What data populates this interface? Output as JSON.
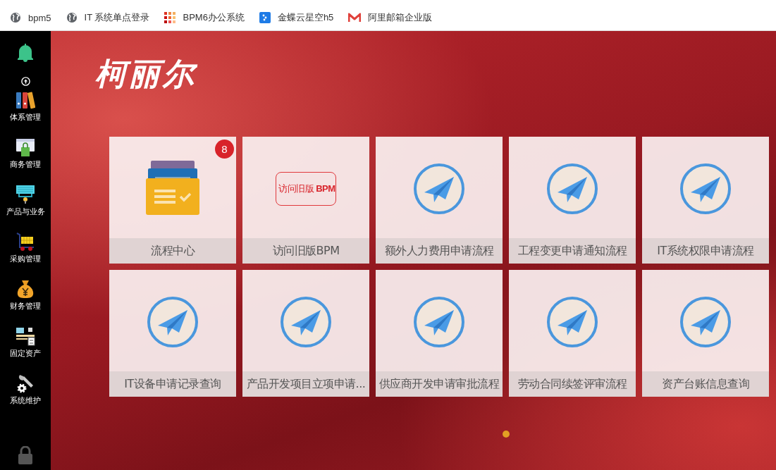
{
  "bookmarks": [
    {
      "label": "bpm5",
      "kind": "globe"
    },
    {
      "label": "IT 系统单点登录",
      "kind": "globe"
    },
    {
      "label": "BPM6办公系统",
      "kind": "grid"
    },
    {
      "label": "金蝶云星空h5",
      "kind": "dots"
    },
    {
      "label": "阿里邮箱企业版",
      "kind": "mail"
    }
  ],
  "sidebar": {
    "items": [
      {
        "label": "体系管理",
        "kind": "binders"
      },
      {
        "label": "商务管理",
        "kind": "bag"
      },
      {
        "label": "产品与业务",
        "kind": "keyboard"
      },
      {
        "label": "采购管理",
        "kind": "cart"
      },
      {
        "label": "财务管理",
        "kind": "money"
      },
      {
        "label": "固定资产",
        "kind": "assets"
      },
      {
        "label": "系统维护",
        "kind": "tools"
      }
    ]
  },
  "brand": "柯丽尔",
  "tiles": [
    {
      "label": "流程中心",
      "kind": "folder",
      "badge": "8"
    },
    {
      "label": "访问旧版BPM",
      "kind": "stamp",
      "stamp": "访问旧版 **BPM**"
    },
    {
      "label": "额外人力费用申请流程",
      "kind": "plane"
    },
    {
      "label": "工程变更申请通知流程",
      "kind": "plane"
    },
    {
      "label": "IT系统权限申请流程",
      "kind": "plane"
    },
    {
      "label": "IT设备申请记录查询",
      "kind": "plane"
    },
    {
      "label": "产品开发项目立项申请...",
      "kind": "plane"
    },
    {
      "label": "供应商开发申请审批流程",
      "kind": "plane"
    },
    {
      "label": "劳动合同续签评审流程",
      "kind": "plane"
    },
    {
      "label": "资产台账信息查询",
      "kind": "plane"
    }
  ]
}
